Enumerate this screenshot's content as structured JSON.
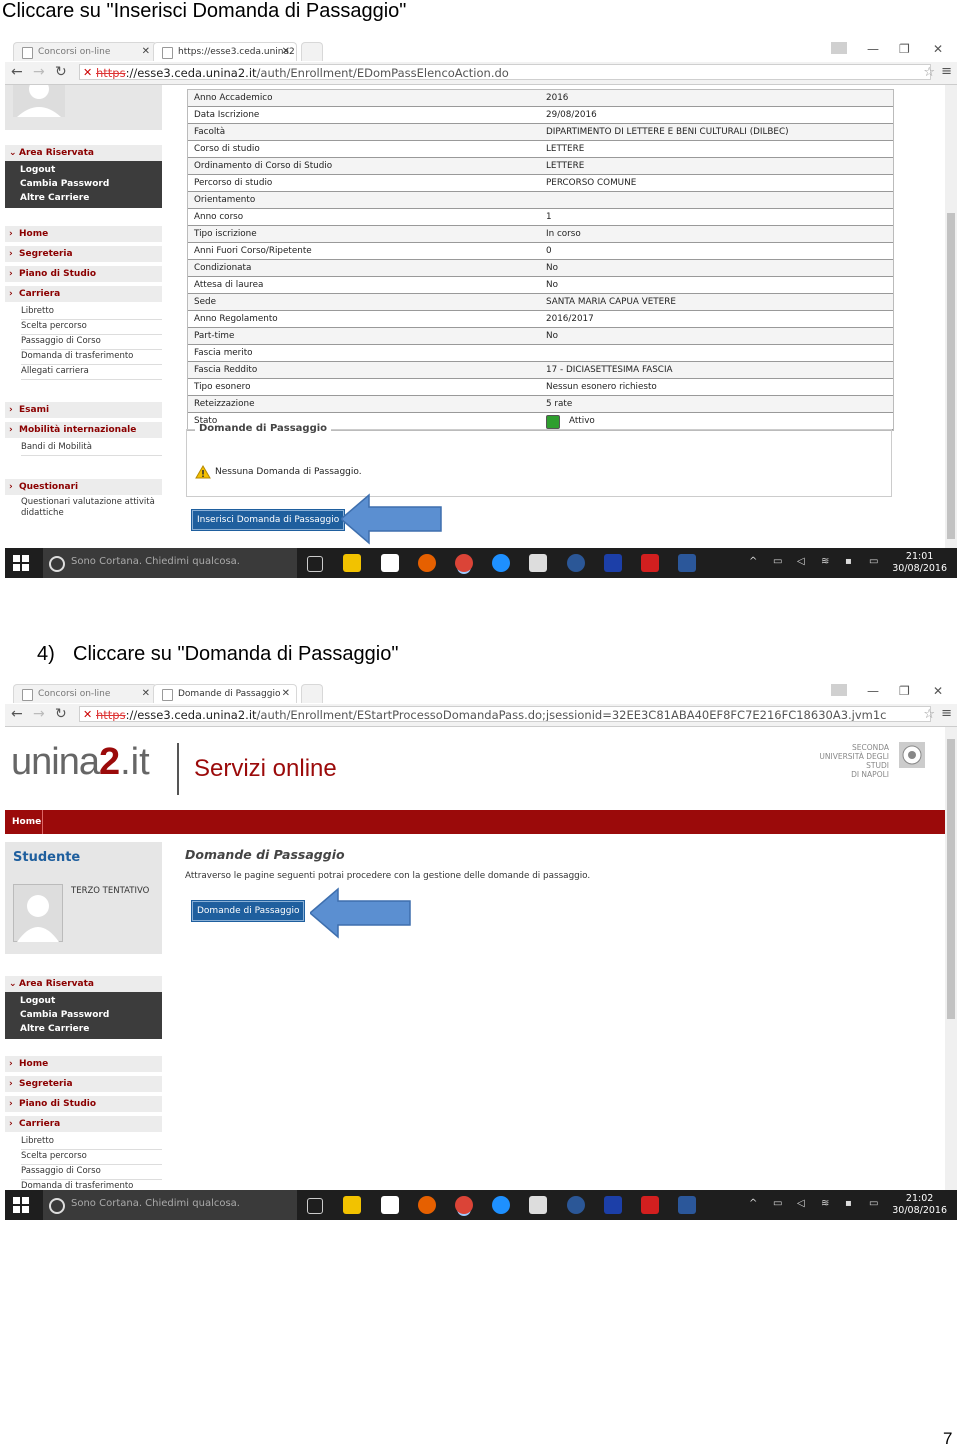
{
  "captions": {
    "top": "Cliccare su \"Inserisci Domanda di Passaggio\"",
    "step_number": "4)",
    "step_text": "Cliccare su \"Domanda di Passaggio\""
  },
  "page_number": "7",
  "shot1": {
    "tabs": [
      {
        "label": "Concorsi on-line"
      },
      {
        "label": "https://esse3.ceda.unina2"
      }
    ],
    "url": {
      "scheme": "https",
      "rest_host": "://esse3.ceda.unina2.it",
      "path": "/auth/Enrollment/EDomPassElencoAction.do"
    },
    "sidebar": {
      "area_riservata": "Area Riservata",
      "dark_items": [
        "Logout",
        "Cambia Password",
        "Altre Carriere"
      ],
      "home": "Home",
      "segreteria": "Segreteria",
      "piano": "Piano di Studio",
      "carriera": "Carriera",
      "carriera_items": [
        "Libretto",
        "Scelta percorso",
        "Passaggio di Corso",
        "Domanda di trasferimento",
        "Allegati carriera"
      ],
      "esami": "Esami",
      "mobilita": "Mobilità internazionale",
      "mobilita_items": [
        "Bandi di Mobilità"
      ],
      "questionari": "Questionari",
      "questionari_items": [
        "Questionari valutazione attività didattiche"
      ]
    },
    "table": [
      {
        "k": "Anno Accademico",
        "v": "2016"
      },
      {
        "k": "Data Iscrizione",
        "v": "29/08/2016"
      },
      {
        "k": "Facoltà",
        "v": "DIPARTIMENTO DI LETTERE E BENI CULTURALI (DILBEC)"
      },
      {
        "k": "Corso di studio",
        "v": "LETTERE"
      },
      {
        "k": "Ordinamento di Corso di Studio",
        "v": "LETTERE"
      },
      {
        "k": "Percorso di studio",
        "v": "PERCORSO COMUNE"
      },
      {
        "k": "Orientamento",
        "v": ""
      },
      {
        "k": "Anno corso",
        "v": "1"
      },
      {
        "k": "Tipo iscrizione",
        "v": "In corso"
      },
      {
        "k": "Anni Fuori Corso/Ripetente",
        "v": "0"
      },
      {
        "k": "Condizionata",
        "v": "No"
      },
      {
        "k": "Attesa di laurea",
        "v": "No"
      },
      {
        "k": "Sede",
        "v": "SANTA MARIA CAPUA VETERE"
      },
      {
        "k": "Anno Regolamento",
        "v": "2016/2017"
      },
      {
        "k": "Part-time",
        "v": "No"
      },
      {
        "k": "Fascia merito",
        "v": ""
      },
      {
        "k": "Fascia Reddito",
        "v": "17 - DICIASETTESIMA FASCIA"
      },
      {
        "k": "Tipo esonero",
        "v": "Nessun esonero richiesto"
      },
      {
        "k": "Reteizzazione",
        "v": "5 rate"
      },
      {
        "k": "Stato",
        "v": "Attivo"
      }
    ],
    "fieldset_title": "Domande di Passaggio",
    "warning_text": "Nessuna Domanda di Passaggio.",
    "button_label": "Inserisci Domanda di Passaggio",
    "taskbar": {
      "search": "Sono Cortana. Chiedimi qualcosa.",
      "time": "21:01",
      "date": "30/08/2016"
    }
  },
  "shot2": {
    "tabs": [
      {
        "label": "Concorsi on-line"
      },
      {
        "label": "Domande di Passaggio"
      }
    ],
    "url": {
      "scheme": "https",
      "rest_host": "://esse3.ceda.unina2.it",
      "path": "/auth/Enrollment/EStartProcessoDomandaPass.do;jsessionid=32EE3C81ABA40EF8FC7E216FC18630A3.jvm1c"
    },
    "logo": {
      "unina": "unina",
      "two": "2",
      "dotit": ".it",
      "servizi": "Servizi online",
      "seconda": [
        "SECONDA",
        "UNIVERSITÀ DEGLI STUDI",
        "DI NAPOLI"
      ]
    },
    "nav_home": "Home",
    "studente": "Studente",
    "user_name": "TERZO TENTATIVO",
    "page_title": "Domande di Passaggio",
    "page_desc": "Attraverso le pagine seguenti potrai procedere con la gestione delle domande di passaggio.",
    "button_label": "Domande di Passaggio",
    "sidebar": {
      "area_riservata": "Area Riservata",
      "dark_items": [
        "Logout",
        "Cambia Password",
        "Altre Carriere"
      ],
      "home": "Home",
      "segreteria": "Segreteria",
      "piano": "Piano di Studio",
      "carriera": "Carriera",
      "carriera_items": [
        "Libretto",
        "Scelta percorso",
        "Passaggio di Corso",
        "Domanda di trasferimento"
      ]
    },
    "taskbar": {
      "search": "Sono Cortana. Chiedimi qualcosa.",
      "time": "21:02",
      "date": "30/08/2016"
    }
  },
  "colors": {
    "brand_red": "#9b0a0a",
    "link_red": "#8b0000",
    "button_blue": "#1f5f9e",
    "arrow_blue": "#5b8fd1"
  }
}
